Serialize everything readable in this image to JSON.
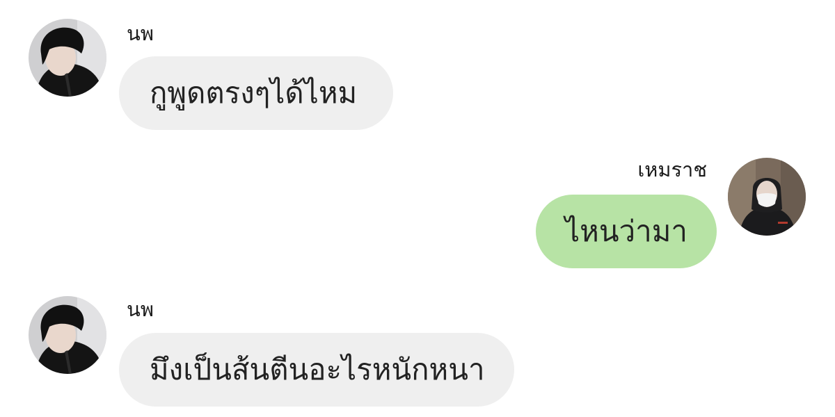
{
  "messages": [
    {
      "direction": "incoming",
      "sender": "นพ",
      "text": "กูพูดตรงๆได้ไหม",
      "avatar_icon": "user-avatar-dark-hair"
    },
    {
      "direction": "outgoing",
      "sender": "เหมราช",
      "text": "ไหนว่ามา",
      "avatar_icon": "user-avatar-masked"
    },
    {
      "direction": "incoming",
      "sender": "นพ",
      "text": "มึงเป็นส้นตีนอะไรหนักหนา",
      "avatar_icon": "user-avatar-dark-hair"
    }
  ],
  "colors": {
    "incoming_bubble": "#efefef",
    "outgoing_bubble": "#b7e3a5",
    "background": "#ffffff",
    "text": "#222222"
  }
}
